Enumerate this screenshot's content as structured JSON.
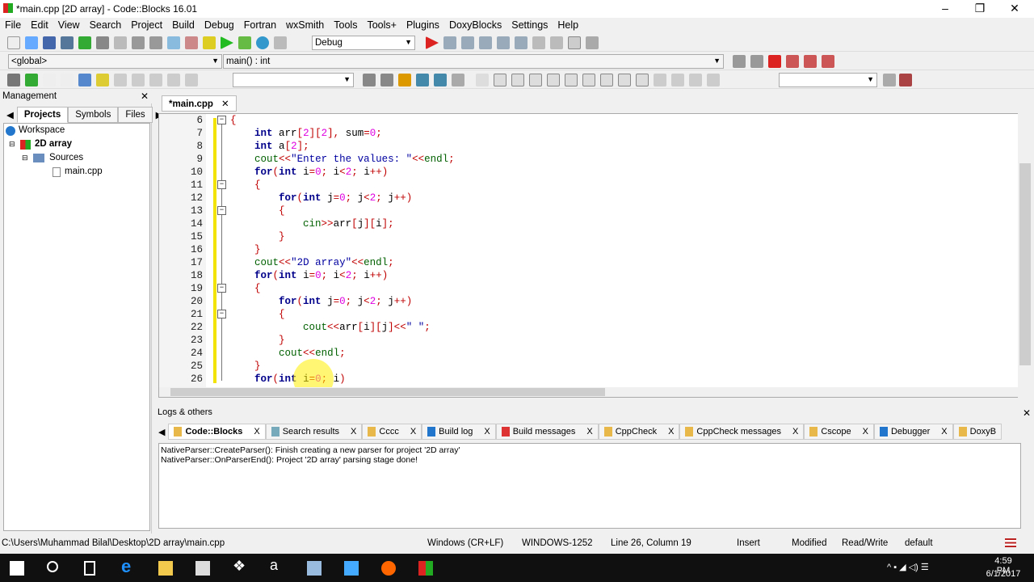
{
  "window": {
    "title": "*main.cpp [2D array] - Code::Blocks 16.01"
  },
  "menu": [
    "File",
    "Edit",
    "View",
    "Search",
    "Project",
    "Build",
    "Debug",
    "Fortran",
    "wxSmith",
    "Tools",
    "Tools+",
    "Plugins",
    "DoxyBlocks",
    "Settings",
    "Help"
  ],
  "toolbar": {
    "build_target": "Debug",
    "scope": "<global>",
    "function": "main() : int",
    "search_value": ""
  },
  "management": {
    "title": "Management",
    "tabs": [
      "Projects",
      "Symbols",
      "Files"
    ],
    "tree": {
      "workspace": "Workspace",
      "project": "2D array",
      "folder": "Sources",
      "file": "main.cpp"
    }
  },
  "editor": {
    "tab": "*main.cpp",
    "first_line": 6,
    "lines": [
      "{",
      "    int arr[2][2], sum=0;",
      "    int a[2];",
      "    cout<<\"Enter the values: \"<<endl;",
      "    for(int i=0; i<2; i++)",
      "    {",
      "        for(int j=0; j<2; j++)",
      "        {",
      "            cin>>arr[j][i];",
      "        }",
      "    }",
      "    cout<<\"2D array\"<<endl;",
      "    for(int i=0; i<2; i++)",
      "    {",
      "        for(int j=0; j<2; j++)",
      "        {",
      "            cout<<arr[i][j]<<\" \";",
      "        }",
      "        cout<<endl;",
      "    }",
      "    for(int i=0; i)"
    ],
    "fold_lines": [
      6,
      11,
      13,
      19,
      21
    ]
  },
  "logs": {
    "title": "Logs & others",
    "tabs": [
      "Code::Blocks",
      "Search results",
      "Cccc",
      "Build log",
      "Build messages",
      "CppCheck",
      "CppCheck messages",
      "Cscope",
      "Debugger",
      "DoxyB"
    ],
    "messages": [
      "NativeParser::CreateParser(): Finish creating a new parser for project '2D array'",
      "NativeParser::OnParserEnd(): Project '2D array' parsing stage done!"
    ]
  },
  "status": {
    "path": "C:\\Users\\Muhammad Bilal\\Desktop\\2D array\\main.cpp",
    "eol": "Windows (CR+LF)",
    "encoding": "WINDOWS-1252",
    "position": "Line 26, Column 19",
    "mode": "Insert",
    "modified": "Modified",
    "access": "Read/Write",
    "profile": "default"
  },
  "taskbar": {
    "time": "4:59 PM",
    "date": "6/1/2017"
  }
}
